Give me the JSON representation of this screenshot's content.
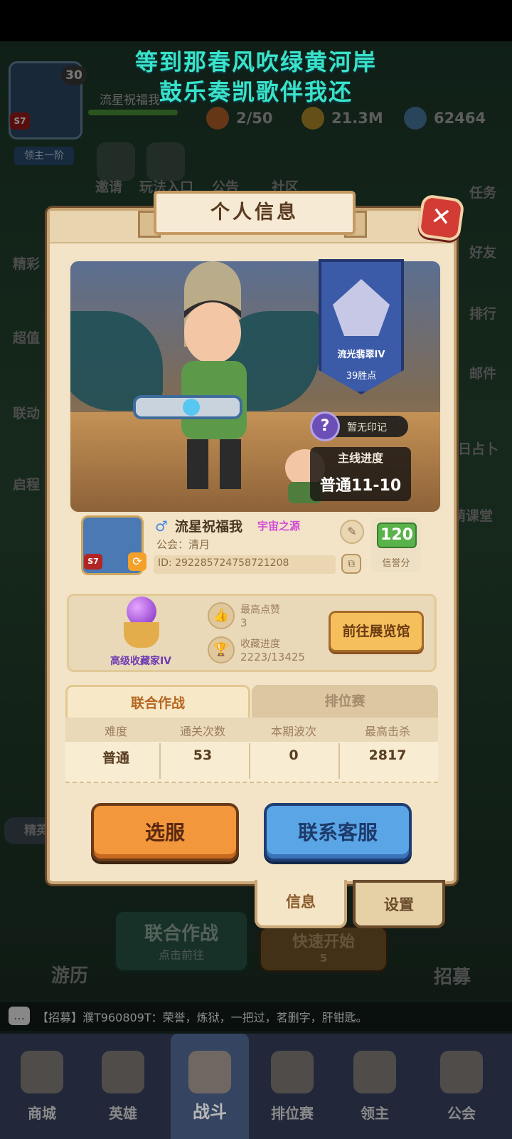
{
  "lyrics": [
    "等到那春风吹绿黄河岸",
    "鼓乐奏凯歌伴我还"
  ],
  "hud": {
    "level": "30",
    "season_badge": "S7",
    "rank_btn": "领主一阶",
    "name": "流星祝福我",
    "stamina": "2/50",
    "gold": "21.3M",
    "crystal": "62464"
  },
  "lobby_icons": {
    "invite": "邀请",
    "play_entry": "玩法入口",
    "notice": "公告",
    "community": "社区",
    "left": [
      "精彩",
      "超值",
      "联动",
      "启程"
    ],
    "right": [
      "任务",
      "好友",
      "排行",
      "邮件",
      "日占卜",
      "萌课堂"
    ]
  },
  "modal": {
    "title": "个人信息",
    "close": "✕",
    "rank": {
      "name": "流光翡翠IV",
      "points": "39胜点"
    },
    "seal": {
      "icon": "?",
      "text": "暂无印记"
    },
    "progress": {
      "label": "主线进度",
      "value": "普通11-10"
    },
    "player": {
      "season": "S7",
      "gender": "♂",
      "name": "流星祝福我",
      "title_tag": "宇宙之源",
      "guild": "公会：清月",
      "uid": "ID: 292285724758721208",
      "credit_score": "120",
      "credit_label": "信誉分"
    },
    "collection": {
      "collector_title": "高级收藏家IV",
      "max_likes_label": "最高点赞",
      "max_likes_value": "3",
      "progress_label": "收藏进度",
      "progress_value": "2223/13425",
      "gallery_button": "前往展览馆"
    },
    "tabs": [
      "联合作战",
      "排位赛"
    ],
    "table": {
      "headers": [
        "难度",
        "通关次数",
        "本期波次",
        "最高击杀"
      ],
      "row": [
        "普通",
        "53",
        "0",
        "2817"
      ]
    },
    "select_server": "选服",
    "contact_service": "联系客服",
    "bottom_tabs": [
      "信息",
      "设置"
    ]
  },
  "lobby": {
    "elite": "精英",
    "joint_battle": "联合作战",
    "joint_battle_sub": "点击前往",
    "quick_start": "快速开始",
    "quick_start_cost": "5",
    "travel": "游历",
    "recruit": "招募"
  },
  "chat": {
    "icon": "…",
    "text": "【招募】濮T960809T：荣誉，炼狱，一把过，茗删字，肝钳匙。"
  },
  "nav": [
    "商城",
    "英雄",
    "战斗",
    "排位赛",
    "领主",
    "公会"
  ],
  "colors": {
    "accent_orange": "#f2973b",
    "accent_blue": "#5aa5e6",
    "lyric": "#39e3c8",
    "credit_green": "#5ab24a"
  }
}
